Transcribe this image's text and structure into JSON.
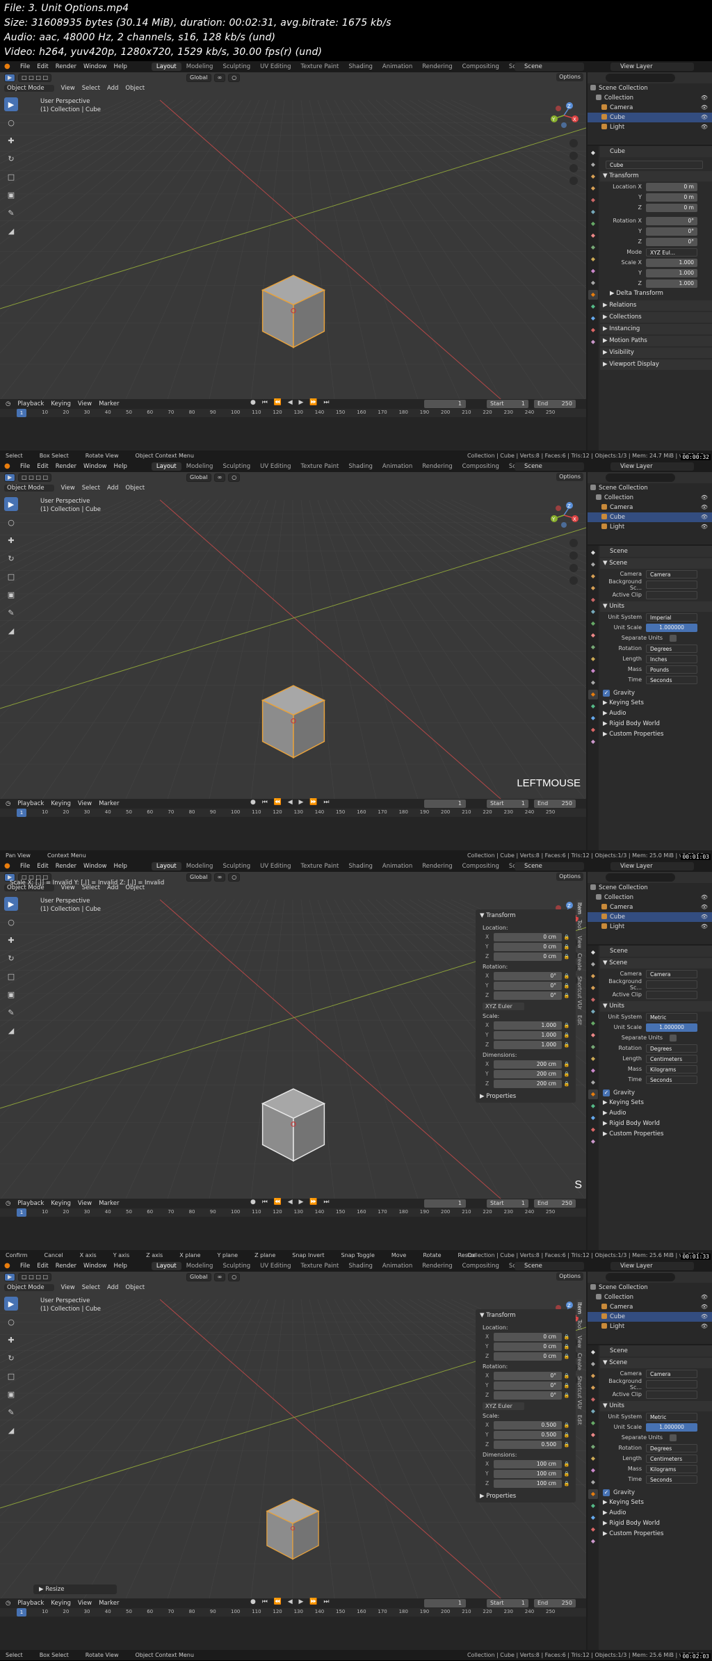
{
  "info": [
    "File: 3. Unit Options.mp4",
    "Size: 31608935 bytes (30.14 MiB), duration: 00:02:31, avg.bitrate: 1675 kb/s",
    "Audio: aac, 48000 Hz, 2 channels, s16, 128 kb/s (und)",
    "Video: h264, yuv420p, 1280x720, 1529 kb/s, 30.00 fps(r) (und)"
  ],
  "menu": [
    "File",
    "Edit",
    "Render",
    "Window",
    "Help"
  ],
  "workspaces": [
    "Layout",
    "Modeling",
    "Sculpting",
    "UV Editing",
    "Texture Paint",
    "Shading",
    "Animation",
    "Rendering",
    "Compositing",
    "Scripting"
  ],
  "scene_name": "Scene",
  "view_layer": "View Layer",
  "outliner": {
    "items": [
      "Scene Collection",
      "Collection",
      "Camera",
      "Cube",
      "Light"
    ]
  },
  "viewport_header": {
    "global": "Global",
    "options": "Options",
    "object_mode": "Object Mode",
    "menus": [
      "View",
      "Select",
      "Add",
      "Object"
    ]
  },
  "viewport": {
    "perspective": "User Perspective",
    "collection": "(1) Collection | Cube"
  },
  "timeline": {
    "menus": [
      "Playback",
      "Keying",
      "View",
      "Marker"
    ],
    "current_frame": "1",
    "start_label": "Start",
    "start_value": "1",
    "end_label": "End",
    "end_value": "250",
    "ticks": [
      "1",
      "10",
      "20",
      "30",
      "40",
      "50",
      "60",
      "70",
      "80",
      "90",
      "100",
      "110",
      "120",
      "130",
      "140",
      "150",
      "160",
      "170",
      "180",
      "190",
      "200",
      "210",
      "220",
      "230",
      "240",
      "250"
    ]
  },
  "frames": [
    {
      "timestamp": "00:00:32",
      "status_left": [
        "Select",
        "Box Select",
        "Rotate View",
        "Object Context Menu"
      ],
      "stats": "Collection | Cube | Verts:8 | Faces:6 | Tris:12 | Objects:1/3 | Mem: 24.7 MiB | v2.81.16",
      "props_header": "Cube",
      "object_name": "Cube",
      "transform_title": "Transform",
      "location_x_label": "Location X",
      "location": [
        "0 m",
        "0 m",
        "0 m"
      ],
      "rotation_x_label": "Rotation X",
      "rotation": [
        "0°",
        "0°",
        "0°"
      ],
      "mode_label": "Mode",
      "mode_value": "XYZ Eul...",
      "scale_x_label": "Scale X",
      "scale": [
        "1.000",
        "1.000",
        "1.000"
      ],
      "sections": [
        "Delta Transform",
        "Relations",
        "Collections",
        "Instancing",
        "Motion Paths",
        "Visibility",
        "Viewport Display"
      ]
    },
    {
      "timestamp": "00:01:03",
      "status_left": [
        "Pan View",
        "Context Menu"
      ],
      "stats": "Collection | Cube | Verts:8 | Faces:6 | Tris:12 | Objects:1/3 | Mem: 25.0 MiB | v2.81.16",
      "overlay_text": "LEFTMOUSE",
      "units": {
        "unit_system": "Imperial",
        "unit_scale": "1.000000",
        "rotation": "Degrees",
        "length": "Inches",
        "mass": "Pounds",
        "time": "Seconds"
      }
    },
    {
      "timestamp": "00:01:33",
      "status_left": [
        "Confirm",
        "Cancel",
        "X axis",
        "Y axis",
        "Z axis",
        "X plane",
        "Y plane",
        "Z plane",
        "Snap Invert",
        "Snap Toggle",
        "Move",
        "Rotate",
        "Resize"
      ],
      "stats": "Collection | Cube | Verts:8 | Faces:6 | Tris:12 | Objects:1/3 | Mem: 25.6 MiB | v2.81.16",
      "scale_msg": "Scale X: [.|] = Invalid  Y: [.|] = Invalid  Z: [.|] = Invalid",
      "overlay_text": "S",
      "n_location": [
        "0 cm",
        "0 cm",
        "0 cm"
      ],
      "n_rotation": [
        "0°",
        "0°",
        "0°"
      ],
      "n_scale": [
        "1.000",
        "1.000",
        "1.000"
      ],
      "n_dimensions": [
        "200 cm",
        "200 cm",
        "200 cm"
      ],
      "units": {
        "unit_system": "Metric",
        "unit_scale": "1.000000",
        "rotation": "Degrees",
        "length": "Centimeters",
        "mass": "Kilograms",
        "time": "Seconds"
      }
    },
    {
      "timestamp": "00:02:03",
      "status_left": [
        "Select",
        "Box Select",
        "Rotate View",
        "Object Context Menu"
      ],
      "stats": "Collection | Cube | Verts:8 | Faces:6 | Tris:12 | Objects:1/3 | Mem: 25.6 MiB | v2.81.16",
      "resize_panel": "Resize",
      "n_location": [
        "0 cm",
        "0 cm",
        "0 cm"
      ],
      "n_rotation": [
        "0°",
        "0°",
        "0°"
      ],
      "n_scale": [
        "0.500",
        "0.500",
        "0.500"
      ],
      "n_dimensions": [
        "100 cm",
        "100 cm",
        "100 cm"
      ],
      "units": {
        "unit_system": "Metric",
        "unit_scale": "1.000000",
        "rotation": "Degrees",
        "length": "Centimeters",
        "mass": "Kilograms",
        "time": "Seconds"
      }
    }
  ],
  "npanel_labels": {
    "title": "Transform",
    "location": "Location:",
    "rotation": "Rotation:",
    "euler": "XYZ Euler",
    "scale": "Scale:",
    "dimensions": "Dimensions:",
    "properties": "Properties",
    "tabs": [
      "Item",
      "Tool",
      "View",
      "Create",
      "Shortcut VUr",
      "Edit"
    ]
  },
  "scene_props": {
    "header": "Scene",
    "section": "Scene",
    "camera_label": "Camera",
    "camera_value": "Camera",
    "bg_label": "Background Sc...",
    "clip_label": "Active Clip",
    "units_title": "Units",
    "unit_system_label": "Unit System",
    "unit_scale_label": "Unit Scale",
    "separate_label": "Separate Units",
    "rotation_label": "Rotation",
    "length_label": "Length",
    "mass_label": "Mass",
    "time_label": "Time",
    "gravity": "Gravity",
    "after": [
      "Keying Sets",
      "Audio",
      "Rigid Body World",
      "Custom Properties"
    ]
  },
  "axis_labels": [
    "X",
    "Y",
    "Z"
  ],
  "colors": {
    "accent": "#4772b3",
    "selection_orange": "#e8a23c",
    "x_axis": "#b54848",
    "y_axis": "#8ba03a"
  }
}
